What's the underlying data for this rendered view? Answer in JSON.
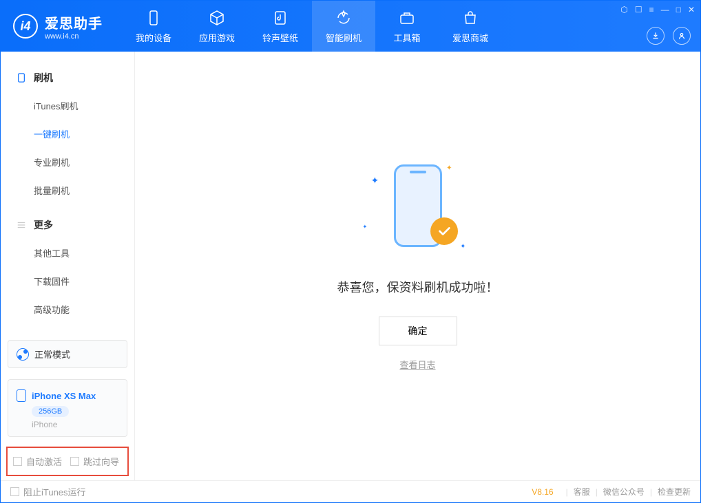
{
  "app": {
    "title": "爱思助手",
    "subtitle": "www.i4.cn"
  },
  "nav": {
    "tabs": [
      {
        "label": "我的设备",
        "icon": "device"
      },
      {
        "label": "应用游戏",
        "icon": "cube"
      },
      {
        "label": "铃声壁纸",
        "icon": "music"
      },
      {
        "label": "智能刷机",
        "icon": "refresh",
        "active": true
      },
      {
        "label": "工具箱",
        "icon": "toolbox"
      },
      {
        "label": "爱思商城",
        "icon": "bag"
      }
    ]
  },
  "sidebar": {
    "sections": [
      {
        "header": "刷机",
        "icon": "phone",
        "items": [
          {
            "label": "iTunes刷机"
          },
          {
            "label": "一键刷机",
            "active": true
          },
          {
            "label": "专业刷机"
          },
          {
            "label": "批量刷机"
          }
        ]
      },
      {
        "header": "更多",
        "icon": "menu",
        "items": [
          {
            "label": "其他工具"
          },
          {
            "label": "下载固件"
          },
          {
            "label": "高级功能"
          }
        ]
      }
    ],
    "mode_label": "正常模式",
    "device": {
      "name": "iPhone XS Max",
      "storage": "256GB",
      "type": "iPhone"
    },
    "checkboxes": {
      "auto_activate": "自动激活",
      "skip_guide": "跳过向导"
    }
  },
  "main": {
    "success_text": "恭喜您，保资料刷机成功啦！",
    "ok_button": "确定",
    "log_link": "查看日志"
  },
  "footer": {
    "block_itunes": "阻止iTunes运行",
    "version": "V8.16",
    "links": [
      "客服",
      "微信公众号",
      "检查更新"
    ]
  }
}
